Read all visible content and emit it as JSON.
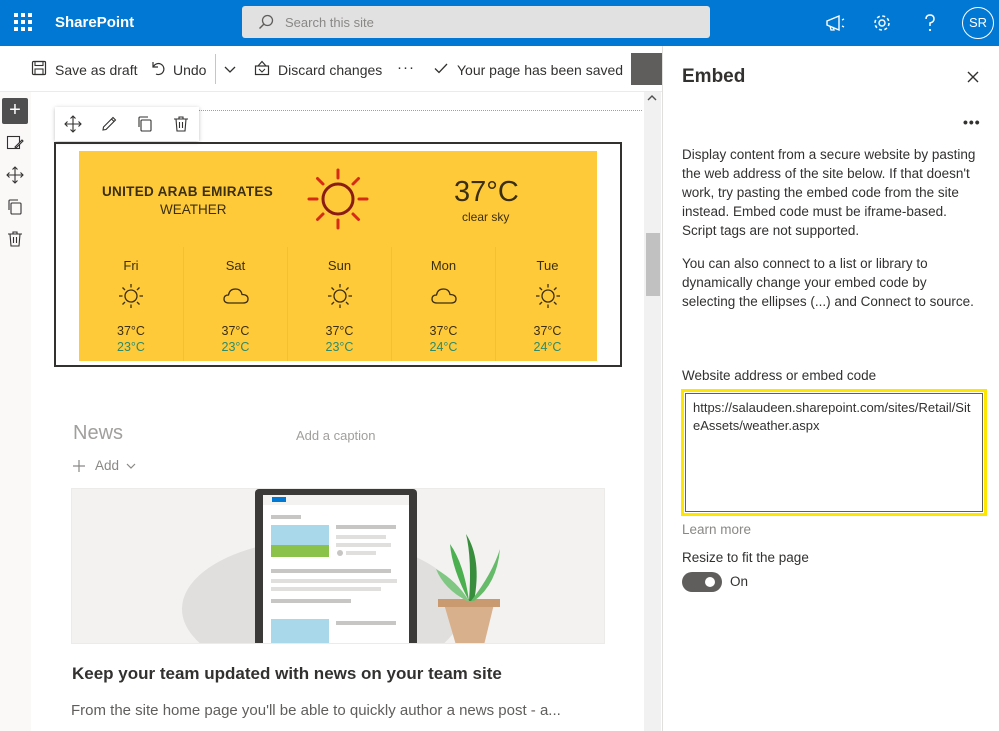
{
  "suitebar": {
    "app_name": "SharePoint",
    "search_placeholder": "Search this site",
    "avatar_initials": "SR",
    "accent": "#0078d4"
  },
  "commandbar": {
    "save_draft": "Save as draft",
    "undo": "Undo",
    "discard": "Discard changes",
    "more": "···",
    "status": "Your page has been saved"
  },
  "weather": {
    "country": "UNITED ARAB EMIRATES",
    "subtitle": "WEATHER",
    "temperature": "37°C",
    "condition": "clear sky",
    "days": [
      {
        "name": "Fri",
        "icon": "sun-icon",
        "high": "37°C",
        "low": "23°C"
      },
      {
        "name": "Sat",
        "icon": "cloud-icon",
        "high": "37°C",
        "low": "23°C"
      },
      {
        "name": "Sun",
        "icon": "sun-icon",
        "high": "37°C",
        "low": "23°C"
      },
      {
        "name": "Mon",
        "icon": "cloud-icon",
        "high": "37°C",
        "low": "24°C"
      },
      {
        "name": "Tue",
        "icon": "sun-icon",
        "high": "37°C",
        "low": "24°C"
      }
    ]
  },
  "news": {
    "title": "News",
    "caption_placeholder": "Add a caption",
    "add_label": "Add",
    "headline": "Keep your team updated with news on your team site",
    "description": "From the site home page you'll be able to quickly author a news post - a..."
  },
  "panel": {
    "title": "Embed",
    "more": "•••",
    "description1": "Display content from a secure website by pasting the web address of the site below. If that doesn't work, try pasting the embed code from the site instead. Embed code must be iframe-based. Script tags are not supported.",
    "description2": "You can also connect to a list or library to dynamically change your embed code by selecting the ellipses (...) and Connect to source.",
    "field_label": "Website address or embed code",
    "field_value": "https://salaudeen.sharepoint.com/sites/Retail/SiteAssets/weather.aspx",
    "learn_more": "Learn more",
    "resize_label": "Resize to fit the page",
    "toggle_state": "On",
    "highlight_color": "#ffe600"
  }
}
